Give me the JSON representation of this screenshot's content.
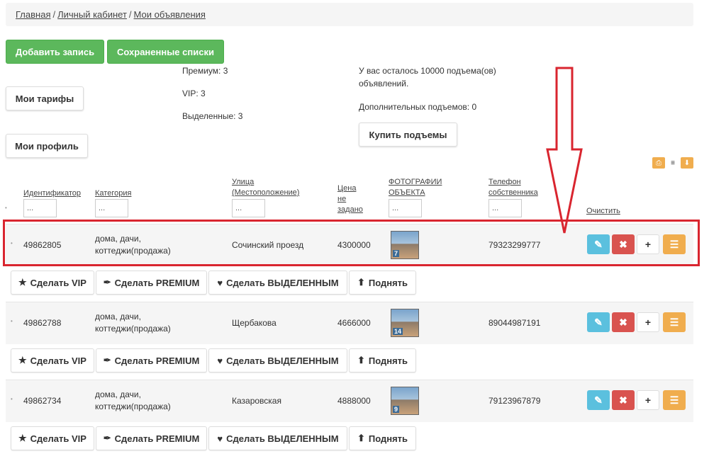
{
  "breadcrumb": {
    "items": [
      "Главная",
      "Личный кабинет",
      "Мои объявления"
    ],
    "separator": "/"
  },
  "buttons": {
    "add_record": "Добавить запись",
    "saved_lists": "Сохраненные списки",
    "my_tariffs": "Мои тарифы",
    "my_profile": "Мои профиль",
    "buy_lifts": "Купить подъемы"
  },
  "stats": {
    "premium": "Премиум: 3",
    "vip": "VIP: 3",
    "highlighted": "Выделенные: 3",
    "remaining_line1": "У вас осталось 10000 подъема(ов)",
    "remaining_line2": "объявлений.",
    "additional": "Дополнительных подъемов: 0"
  },
  "table": {
    "headers": {
      "id": "Идентификатор",
      "category": "Категория",
      "street_line1": "Улица",
      "street_line2": "(Местоположение)",
      "price_line1": "Цена",
      "price_line2": "не",
      "price_line3": "задано",
      "photos_line1": "ФОТОГРАФИИ",
      "photos_line2": "ОБЪЕКТА",
      "phone_line1": "Телефон",
      "phone_line2": "собственника",
      "clear": "Очистить"
    },
    "filter_placeholder": "...",
    "rows": [
      {
        "id": "49862805",
        "category_line1": "дома, дачи,",
        "category_line2": "коттеджи(продажа)",
        "street": "Сочинский проезд",
        "price": "4300000",
        "photo_count": "7",
        "phone": "79323299777"
      },
      {
        "id": "49862788",
        "category_line1": "дома, дачи,",
        "category_line2": "коттеджи(продажа)",
        "street": "Щербакова",
        "price": "4666000",
        "photo_count": "14",
        "phone": "89044987191"
      },
      {
        "id": "49862734",
        "category_line1": "дома, дачи,",
        "category_line2": "коттеджи(продажа)",
        "street": "Казаровская",
        "price": "4888000",
        "photo_count": "9",
        "phone": "79123967879"
      }
    ]
  },
  "row_actions": {
    "make_vip": "Сделать VIP",
    "make_premium": "Сделать PREMIUM",
    "make_highlighted": "Сделать ВЫДЕЛЕННЫМ",
    "raise": "Поднять"
  },
  "icons": {
    "star": "★",
    "pin": "✒",
    "heart": "♥",
    "up": "⬆",
    "pencil": "✎",
    "times": "✖",
    "plus": "+",
    "list": "☰",
    "print": "⎙",
    "menu": "≡",
    "download": "⬇"
  },
  "colors": {
    "green": "#5cb85c",
    "info": "#5bc0de",
    "danger": "#d9534f",
    "warning": "#f0ad4e",
    "annotation_red": "#d9252f"
  }
}
